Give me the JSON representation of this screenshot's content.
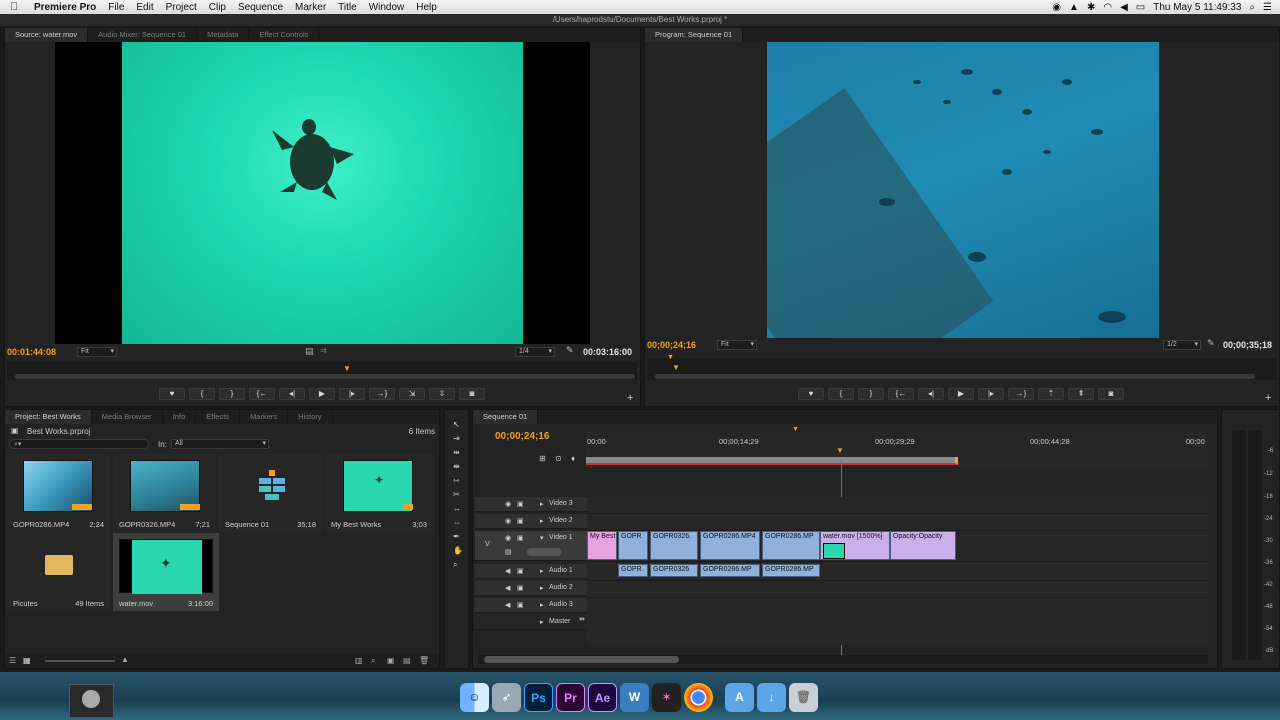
{
  "menubar": {
    "app": "Premiere Pro",
    "items": [
      "File",
      "Edit",
      "Project",
      "Clip",
      "Sequence",
      "Marker",
      "Title",
      "Window",
      "Help"
    ],
    "clock": "Thu May 5  11:49:33"
  },
  "window_title": "/Users/haprodstu/Documents/Best Works.prproj *",
  "source": {
    "tabs": [
      "Source: water.mov",
      "Audio Mixer: Sequence 01",
      "Metadata",
      "Effect Controls"
    ],
    "timecode_current": "00:01:44:08",
    "fit": "Fit",
    "resolution": "1/4",
    "timecode_duration": "00:03:16:00"
  },
  "program": {
    "tabs": [
      "Program: Sequence 01"
    ],
    "timecode_current": "00;00;24;16",
    "fit": "Fit",
    "resolution": "1/2",
    "timecode_duration": "00;00;35;18"
  },
  "project": {
    "tabs": [
      "Project: Best Works",
      "Media Browser",
      "Info",
      "Effects",
      "Markers",
      "History"
    ],
    "filename": "Best Works.prproj",
    "item_count": "6 Items",
    "in_label": "In:",
    "in_value": "All",
    "items": [
      {
        "name": "GOPR0286.MP4",
        "duration": "2;24"
      },
      {
        "name": "GOPR0326.MP4",
        "duration": "7;21"
      },
      {
        "name": "Sequence 01",
        "duration": "35;18"
      },
      {
        "name": "My Best Works",
        "duration": "3;03"
      },
      {
        "name": "Picutes",
        "duration": "49 Items"
      },
      {
        "name": "water.mov",
        "duration": "3:16:00"
      }
    ]
  },
  "sequence": {
    "tab": "Sequence 01",
    "timecode": "00;00;24;16",
    "ruler_labels": [
      "00;00",
      "00;00;14;29",
      "00;00;29;29",
      "00;00;44;28",
      "00;00"
    ],
    "tracks": [
      "Video 3",
      "Video 2",
      "Video 1",
      "Audio 1",
      "Audio 2",
      "Audio 3",
      "Master"
    ],
    "video_clips": [
      "My Best",
      "GOPR",
      "GOPR0326.",
      "GOPR0286.MP4",
      "GOPR0286.MP",
      "water.mov [1500%]",
      "Opacity:Opacity"
    ],
    "audio_clips": [
      "GOPR",
      "GOPR0326",
      "GOPR0286.MP",
      "GOPR0286.MP"
    ]
  },
  "meter_labels": [
    "-6",
    "-12",
    "-18",
    "-24",
    "-30",
    "-36",
    "-42",
    "-48",
    "-54",
    "dB"
  ]
}
